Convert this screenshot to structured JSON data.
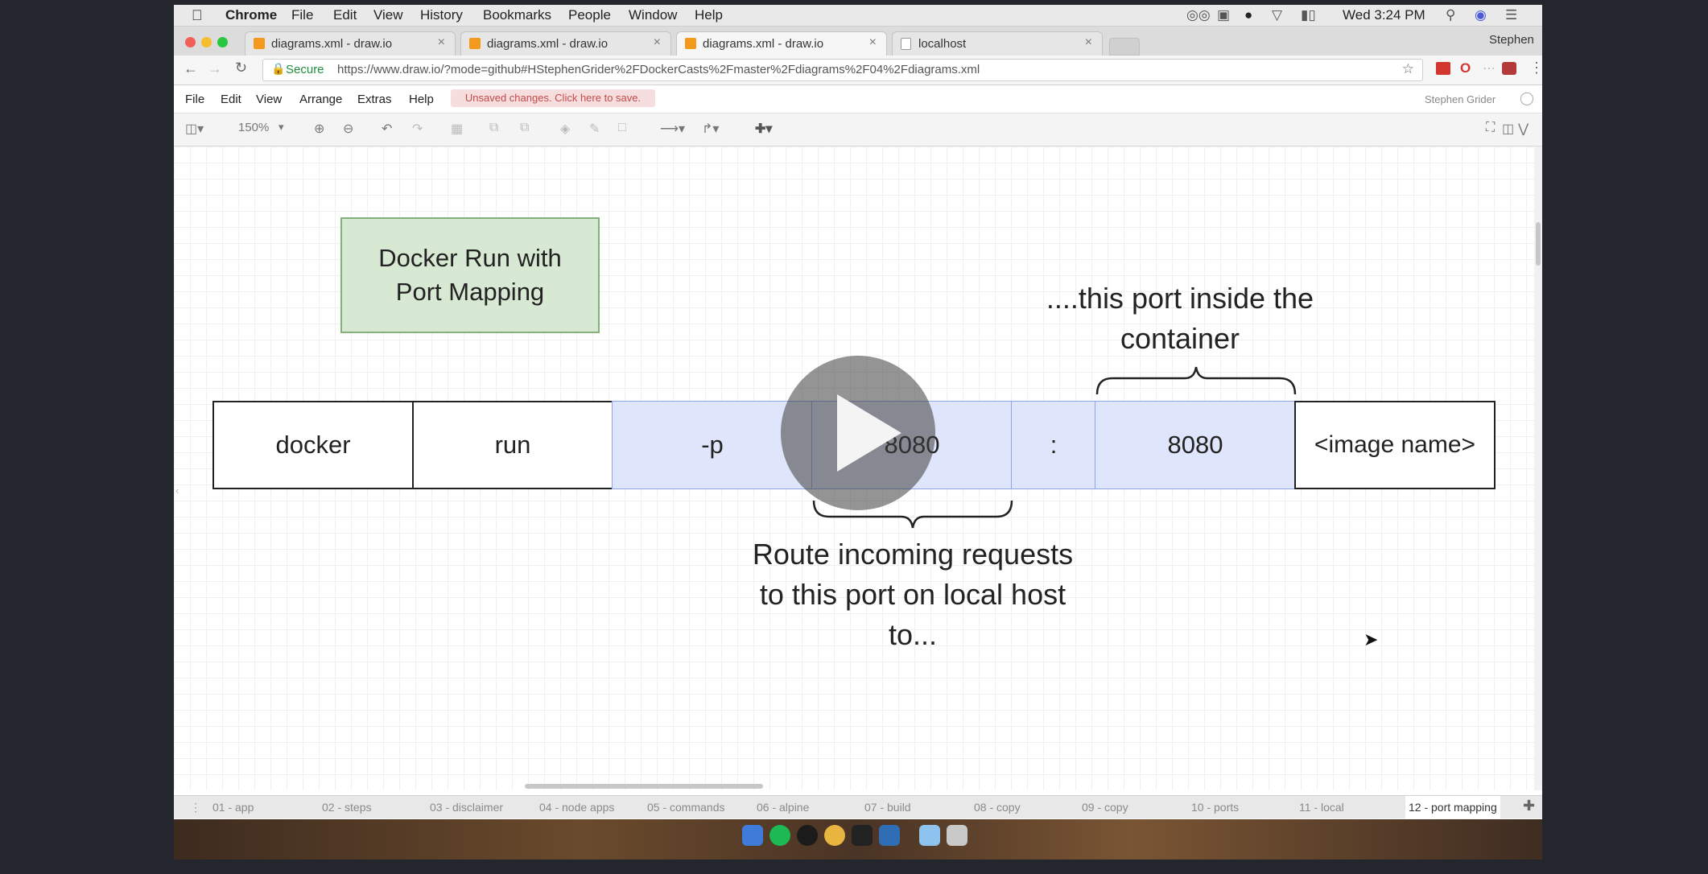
{
  "mac_menubar": {
    "apple": "",
    "items": [
      "Chrome",
      "File",
      "Edit",
      "View",
      "History",
      "Bookmarks",
      "People",
      "Window",
      "Help"
    ],
    "clock": "Wed 3:24 PM"
  },
  "browser": {
    "tabs": [
      {
        "title": "diagrams.xml - draw.io",
        "active": false
      },
      {
        "title": "diagrams.xml - draw.io",
        "active": false
      },
      {
        "title": "diagrams.xml - draw.io",
        "active": true
      },
      {
        "title": "localhost",
        "active": false
      }
    ],
    "profile": "Stephen",
    "secure_label": "Secure",
    "url": "https://www.draw.io/?mode=github#HStephenGrider%2FDockerCasts%2Fmaster%2Fdiagrams%2F04%2Fdiagrams.xml"
  },
  "app": {
    "menu": [
      "File",
      "Edit",
      "View",
      "Arrange",
      "Extras",
      "Help"
    ],
    "unsaved": "Unsaved changes. Click here to save.",
    "user": "Stephen Grider",
    "zoom": "150%"
  },
  "diagram": {
    "title": "Docker Run with Port Mapping",
    "cells": [
      "docker",
      "run",
      "-p",
      "8080",
      ":",
      "8080",
      "<image name>"
    ],
    "top_note": "....this port inside the container",
    "bottom_note": "Route incoming requests to this port on local host to..."
  },
  "sheets": [
    "01 - app",
    "02 - steps",
    "03 - disclaimer",
    "04 - node apps",
    "05 - commands",
    "06 - alpine",
    "07 - build",
    "08 - copy",
    "09 - copy",
    "10 - ports",
    "11 - local",
    "12 - port mapping"
  ],
  "active_sheet": "12 - port mapping"
}
